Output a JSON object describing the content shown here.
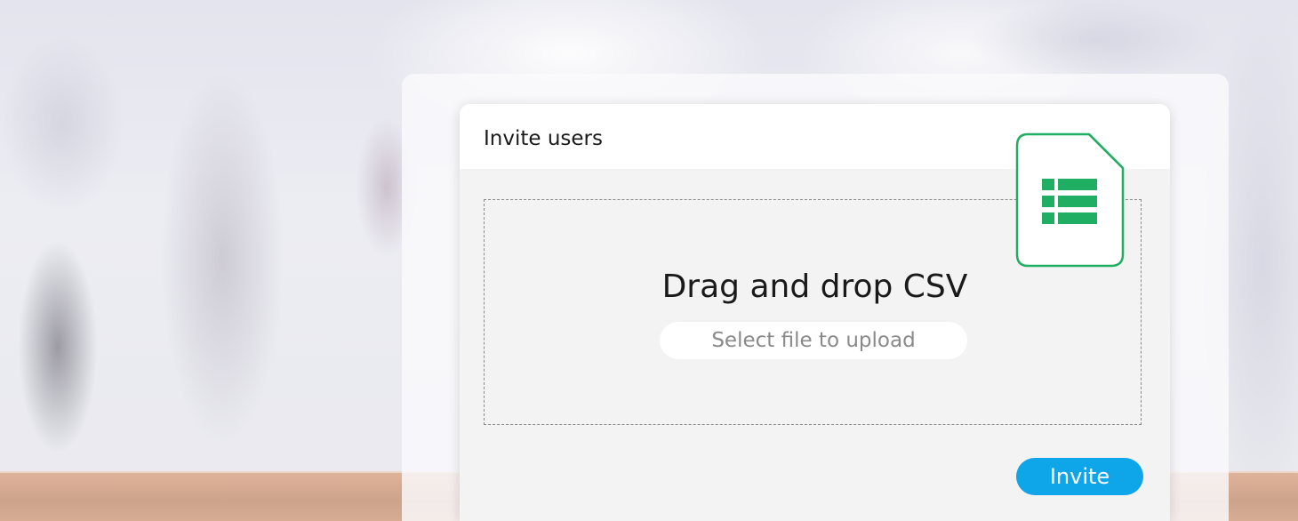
{
  "dialog": {
    "title": "Invite users",
    "dropzone_title": "Drag and drop CSV",
    "select_file_label": "Select file to upload",
    "invite_label": "Invite"
  },
  "icons": {
    "file": "spreadsheet-file-icon"
  },
  "colors": {
    "accent": "#0ea5e9",
    "spreadsheet_green": "#1fae62",
    "dialog_background": "#f3f3f3"
  }
}
